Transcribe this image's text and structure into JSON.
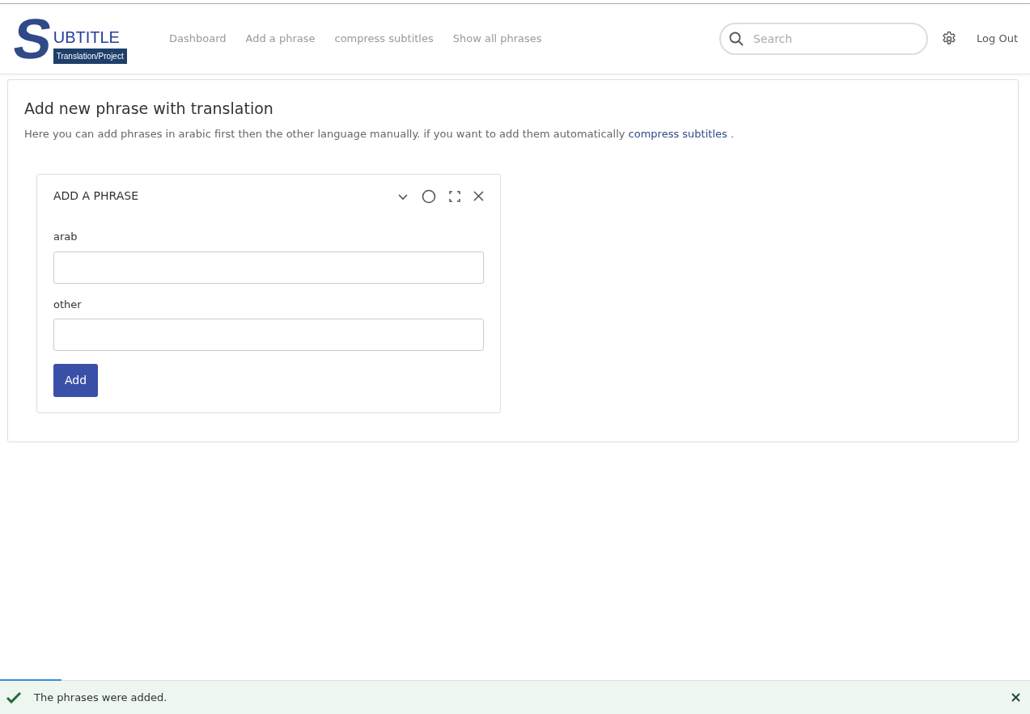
{
  "logo": {
    "initial": "S",
    "title": "UBTITLE",
    "subtitle": "Translation/Project"
  },
  "nav": [
    {
      "label": "Dashboard"
    },
    {
      "label": "Add a phrase"
    },
    {
      "label": "compress subtitles"
    },
    {
      "label": "Show all phrases"
    }
  ],
  "search": {
    "placeholder": "Search"
  },
  "logout": "Log Out",
  "page": {
    "title": "Add new phrase with translation",
    "description": "Here you can add phrases in arabic first then the other language manually. if you want to add them automatically",
    "link": "compress subtitles",
    "after_link": "."
  },
  "widget": {
    "title": "ADD A PHRASE",
    "fields": [
      {
        "label": "arab"
      },
      {
        "label": "other"
      }
    ],
    "button": "Add"
  },
  "toast": {
    "message": "The phrases were added.",
    "level": 0.06
  }
}
